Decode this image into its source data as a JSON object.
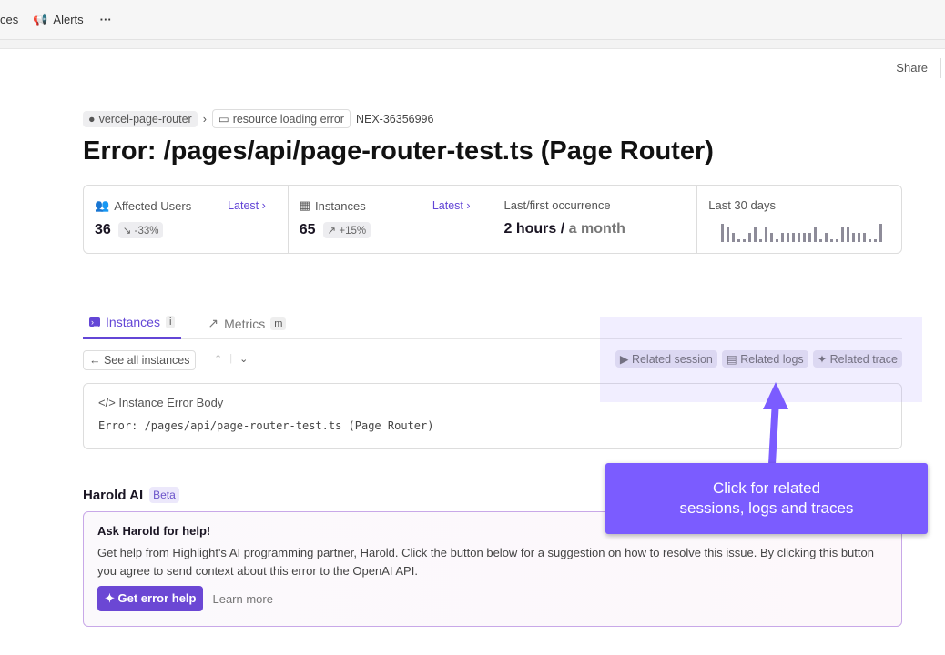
{
  "topbar": {
    "partial_item": "ces",
    "alerts": "Alerts",
    "more": "···"
  },
  "header": {
    "share": "Share"
  },
  "breadcrumb": {
    "project": "vercel-page-router",
    "separator": "›",
    "type": "resource loading error",
    "id": "NEX-36356996"
  },
  "title": "Error: /pages/api/page-router-test.ts (Page Router)",
  "stats": {
    "users": {
      "label": "Affected Users",
      "link": "Latest ›",
      "value": "36",
      "delta": "↘ -33%"
    },
    "instances": {
      "label": "Instances",
      "link": "Latest ›",
      "value": "65",
      "delta": "↗ +15%"
    },
    "occurrence": {
      "label": "Last/first occurrence",
      "last": "2 hours /",
      "first": " a month"
    },
    "spark": {
      "label": "Last 30 days",
      "values": [
        6,
        5,
        3,
        1,
        1,
        3,
        5,
        1,
        5,
        3,
        1,
        3,
        3,
        3,
        3,
        3,
        3,
        5,
        1,
        3,
        1,
        1,
        5,
        5,
        3,
        3,
        3,
        1,
        1,
        6
      ]
    }
  },
  "tabs": [
    {
      "label": "Instances",
      "key": "i"
    },
    {
      "label": "Metrics",
      "key": "m"
    }
  ],
  "instance": {
    "see_all": "← See all instances",
    "up": "⌃",
    "down": "⌄",
    "related": [
      "Related session",
      "Related logs",
      "Related trace"
    ],
    "body_title": "Instance Error Body",
    "body": "Error: /pages/api/page-router-test.ts (Page Router)"
  },
  "harold": {
    "title": "Harold AI",
    "badge": "Beta",
    "heading": "Ask Harold for help!",
    "text": "Get help from Highlight's AI programming partner, Harold. Click the button below for a suggestion on how to resolve this issue. By clicking this button you agree to send context about this error to the OpenAI API.",
    "button": "Get error help",
    "learn": "Learn more"
  },
  "callout": {
    "line1": "Click for related",
    "line2": "sessions, logs and traces"
  },
  "colors": {
    "accent": "#6346d6",
    "callout": "#7b5cff"
  }
}
